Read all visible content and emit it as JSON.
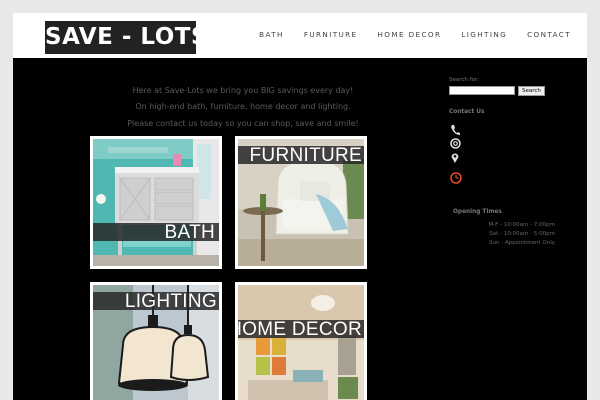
{
  "header": {
    "logo_text": "SAVE - LOTS",
    "nav": [
      "BATH",
      "FURNITURE",
      "HOME DECOR",
      "LIGHTING",
      "CONTACT"
    ]
  },
  "intro": {
    "line1": "Here at Save-Lots we bring you BIG savings every day!",
    "line2": "On high-end bath, furniture, home decor and lighting.",
    "line3": "Please contact us today so you can shop, save and smile!"
  },
  "tiles": {
    "bath": "BATH",
    "furniture": "FURNITURE",
    "lighting": "LIGHTING",
    "home_decor": "HOME DECOR"
  },
  "sidebar": {
    "search_label": "Search for:",
    "search_value": "",
    "search_button": "Search",
    "contact_title": "Contact Us",
    "icons": [
      "phone-icon",
      "email-icon",
      "location-icon",
      "clock-icon"
    ],
    "hours_title": "Opening Times",
    "hours": [
      "M-F - 10:00am - 7:00pm",
      "Sat - 10:00am - 5:00pm",
      "Sun - Appointment Only"
    ]
  },
  "colors": {
    "page_bg": "#000000",
    "header_bg": "#ffffff",
    "logo_bg": "#222222",
    "clock_accent": "#e04a1f"
  }
}
